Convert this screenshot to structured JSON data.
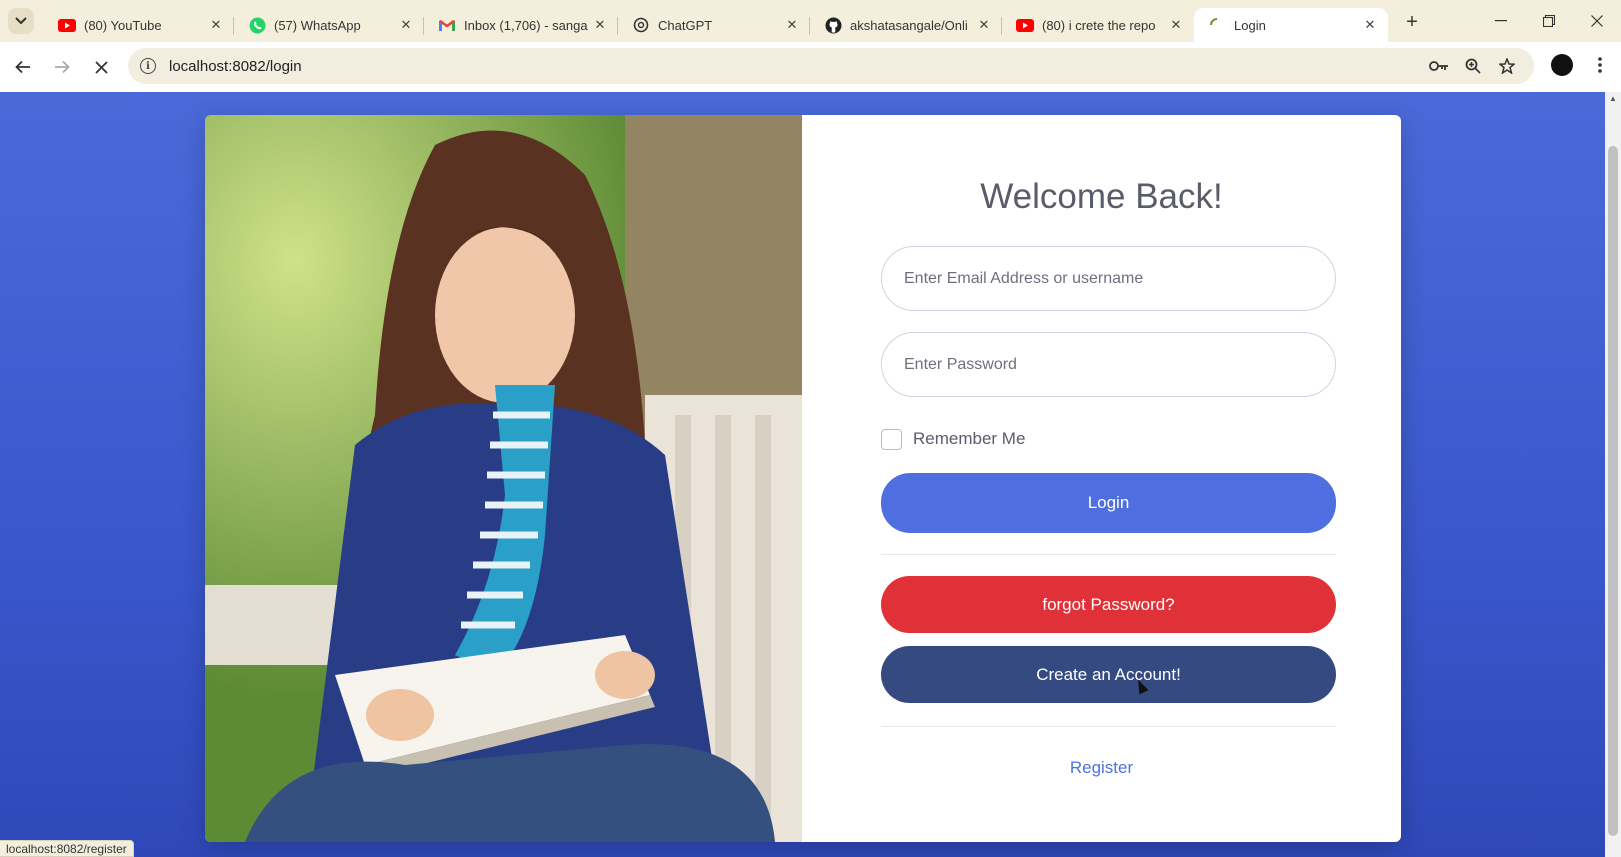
{
  "browser": {
    "tabs": [
      {
        "title": "(80) YouTube",
        "icon": "youtube-icon"
      },
      {
        "title": "(57) WhatsApp",
        "icon": "whatsapp-icon"
      },
      {
        "title": "Inbox (1,706) - sanga",
        "icon": "gmail-icon"
      },
      {
        "title": "ChatGPT",
        "icon": "chatgpt-icon"
      },
      {
        "title": "akshatasangale/Onli",
        "icon": "github-icon"
      },
      {
        "title": "(80) i crete the repo",
        "icon": "youtube-icon"
      },
      {
        "title": "Login",
        "icon": "loading-spinner-icon"
      }
    ],
    "close_glyph": "✕",
    "new_tab_glyph": "+",
    "url": "localhost:8082/login",
    "status_url": "localhost:8082/register"
  },
  "login": {
    "title": "Welcome Back!",
    "email_placeholder": "Enter Email Address or username",
    "password_placeholder": "Enter Password",
    "remember_label": "Remember Me",
    "login_button": "Login",
    "forgot_button": "forgot Password?",
    "create_button": "Create an Account!",
    "register_link": "Register"
  },
  "colors": {
    "background": "#3a57cc",
    "login_button": "#4f6fe0",
    "forgot_button": "#e03138",
    "create_button": "#344a80",
    "link": "#4e73df"
  }
}
